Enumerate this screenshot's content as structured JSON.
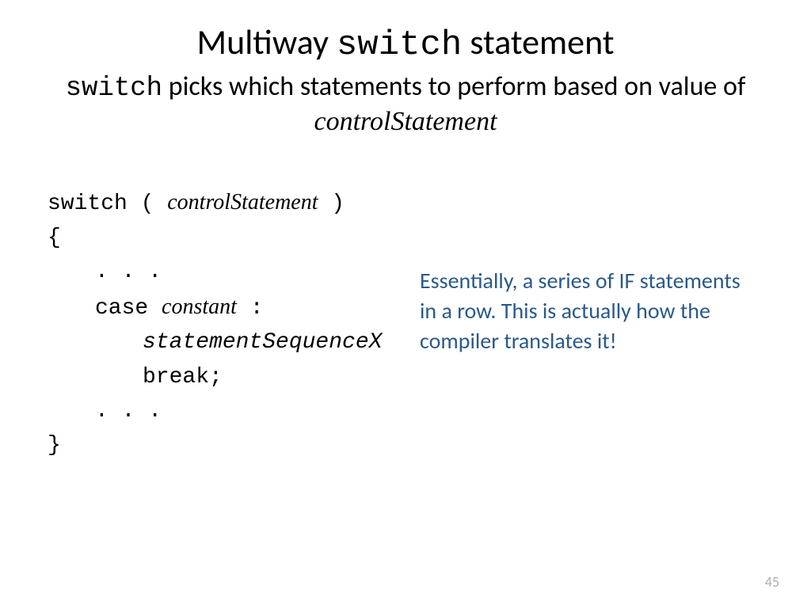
{
  "title": {
    "pre": "Multiway ",
    "mono": "switch",
    "post": " statement"
  },
  "subtitle": {
    "mono": "switch",
    "mid": " picks which statements to perform based on value of ",
    "italic": "controlStatement"
  },
  "code": {
    "l1_pre": "switch ( ",
    "l1_italic": "controlStatement",
    "l1_post": " )",
    "l2": "{",
    "l3": ". . .",
    "l4_pre": "case ",
    "l4_italic": "constant",
    "l4_post": " :",
    "l5_italic": "statementSequenceX",
    "l6": "break;",
    "l7": ". . .",
    "l8": "}"
  },
  "annotation": "Essentially, a series of IF statements in a row. This is actually how the compiler translates it!",
  "page_number": "45"
}
